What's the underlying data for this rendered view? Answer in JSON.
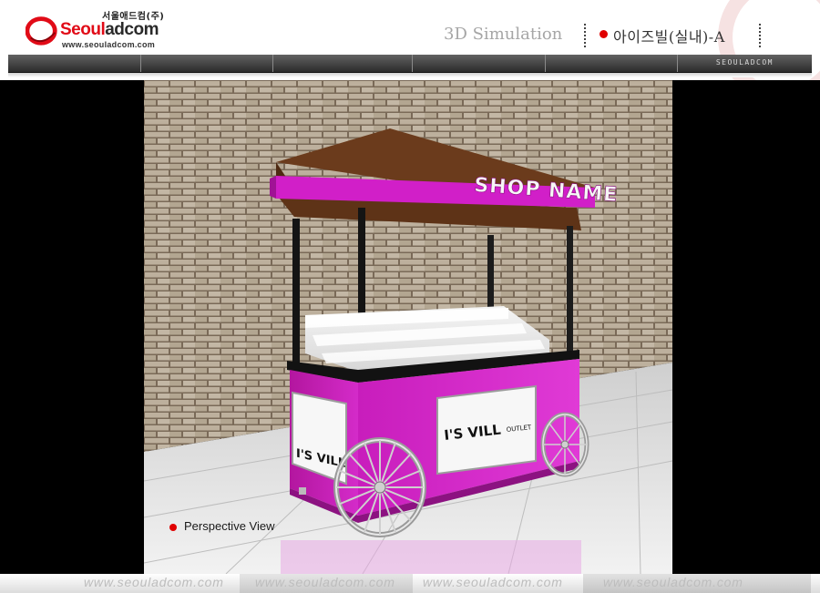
{
  "header": {
    "company_korean": "서울애드컴(주)",
    "logo_name_part1": "Seoul",
    "logo_name_part2": "adcom",
    "logo_url": "www.seouladcom.com",
    "section_title": "3D Simulation",
    "model_name": "아이즈빌(실내)-A"
  },
  "navbar": {
    "brand_label": "SEOULADCOM"
  },
  "scene": {
    "sign_text": "SHOP NAME",
    "panel_brand": "I'S VILL",
    "panel_sub": "OUTLET",
    "view_label": "Perspective View"
  },
  "footer": {
    "url_text": "www.seouladcom.com"
  },
  "colors": {
    "accent_red": "#e00000",
    "cart_magenta": "#d11fc8",
    "roof_brown": "#5e3317",
    "nav_dark": "#2b2b2b"
  }
}
